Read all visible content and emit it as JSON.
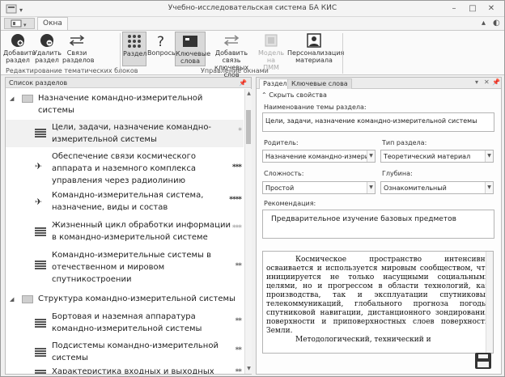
{
  "window": {
    "title": "Учебно-исследовательская система БА КИС",
    "tab_okna": "Окна"
  },
  "ribbon": {
    "buttons": [
      {
        "label1": "Добавить",
        "label2": "раздел",
        "icon": "add-section-icon"
      },
      {
        "label1": "Удалить",
        "label2": "раздел",
        "icon": "delete-section-icon"
      },
      {
        "label1": "Связи",
        "label2": "разделов",
        "icon": "section-links-icon"
      },
      {
        "label1": "Раздел",
        "label2": "",
        "icon": "grid-section-icon"
      },
      {
        "label1": "Вопросы",
        "label2": "",
        "icon": "question-icon"
      },
      {
        "label1": "Ключевые",
        "label2": "слова",
        "icon": "keywords-icon"
      },
      {
        "label1": "Добавить связь",
        "label2": "ключевых слов",
        "icon": "add-keyword-link-icon"
      },
      {
        "label1": "Модель на",
        "label2": "ПММ",
        "icon": "model-icon"
      },
      {
        "label1": "Персонализация",
        "label2": "материала",
        "icon": "personalization-icon"
      }
    ],
    "group1": "Редактирование тематических блоков",
    "group2": "Управление окнами"
  },
  "left_panel": {
    "title": "Список разделов",
    "rows": [
      {
        "type": "folder",
        "line1": "Назначение командно-измерительной",
        "line2": "системы",
        "stars": ""
      },
      {
        "type": "doc",
        "line1": "Цели, задачи, назначение командно-",
        "line2": "измерительной системы",
        "stars": "*"
      },
      {
        "type": "sat",
        "line1": "Обеспечение связи космического",
        "line2": "аппарата и наземного комплекса",
        "line3": "управления через радиолинию",
        "stars": "***"
      },
      {
        "type": "sat",
        "line1": "Командно-измерительная система,",
        "line2": "назначение, виды и состав",
        "stars": "****"
      },
      {
        "type": "doc",
        "line1": "Жизненный цикл обработки информации",
        "line2": "в командно-измерительной системе",
        "stars": "***"
      },
      {
        "type": "doc",
        "line1": "Командно-измерительные системы в",
        "line2": "отечественном и мировом",
        "line3": "спутникостроении",
        "stars": "**"
      },
      {
        "type": "folder",
        "line1": "Структура командно-измерительной системы",
        "stars": ""
      },
      {
        "type": "doc",
        "line1": "Бортовая и наземная аппаратура",
        "line2": "командно-измерительной системы",
        "stars": "**"
      },
      {
        "type": "doc",
        "line1": "Подсистемы командно-измерительной",
        "line2": "системы",
        "stars": "**"
      },
      {
        "type": "doc",
        "line1": "Характеристика входных и выходных",
        "stars": "**"
      }
    ]
  },
  "right_panel": {
    "tabs": [
      "Раздел",
      "Ключевые слова"
    ],
    "hide_props": "Скрыть свойства",
    "topic_label": "Наименование темы раздела:",
    "topic_value": "Цели, задачи, назначение командно-измерительной системы",
    "parent_label": "Родитель:",
    "parent_value": "Назначение командно-измерител",
    "type_label": "Тип раздела:",
    "type_value": "Теоретический материал",
    "complexity_label": "Сложность:",
    "complexity_value": "Простой",
    "depth_label": "Глубина:",
    "depth_value": "Ознакомительный",
    "recommend_label": "Рекомендация:",
    "recommend_value": "Предварительное изучение базовых предметов",
    "body_text": "Космическое пространство интенсивно осваивается и используется мировым сообществом, что инициируется не только насущными социальными целями, но и прогрессом в области технологий, как производства, так и эксплуатации спутниковых телекоммуникаций, глобального прогноза погоды, спутниковой навигации, дистанционного зондирования поверхности и приповерхностных слоев поверхности Земли.",
    "body_text2": "Методологический, технический и"
  }
}
